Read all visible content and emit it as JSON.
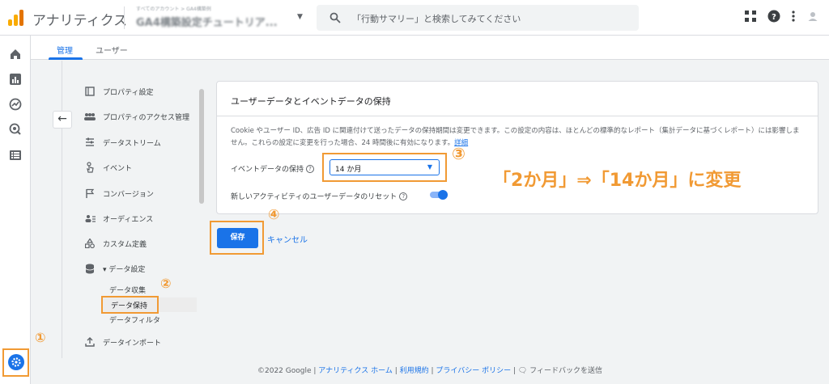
{
  "header": {
    "app_title": "アナリティクス",
    "account_line1": "すべてのアカウント > GA4構築例",
    "account_line2": "GA4構築設定チュートリア...",
    "search_placeholder": "「行動サマリー」と検索してみてください"
  },
  "tabs": [
    {
      "label": "管理"
    },
    {
      "label": "ユーザー"
    }
  ],
  "nav": {
    "items": [
      {
        "label": "プロパティ設定",
        "icon": "property-icon"
      },
      {
        "label": "プロパティのアクセス管理",
        "icon": "people-icon"
      },
      {
        "label": "データストリーム",
        "icon": "stream-icon"
      },
      {
        "label": "イベント",
        "icon": "touch-icon"
      },
      {
        "label": "コンバージョン",
        "icon": "flag-icon"
      },
      {
        "label": "オーディエンス",
        "icon": "audience-icon"
      },
      {
        "label": "カスタム定義",
        "icon": "shapes-icon"
      },
      {
        "label": "▾ データ設定",
        "icon": "database-icon"
      },
      {
        "label": "データインポート",
        "icon": "upload-icon"
      }
    ],
    "sub_items": [
      {
        "label": "データ収集"
      },
      {
        "label": "データ保持"
      },
      {
        "label": "データフィルタ"
      }
    ]
  },
  "card": {
    "title": "ユーザーデータとイベントデータの保持",
    "description": "Cookie やユーザー ID、広告 ID に関連付けて送ったデータの保持期間は変更できます。この設定の内容は、ほとんどの標準的なレポート（集計データに基づくレポート）には影響しません。これらの設定に変更を行った場合、24 時間後に有効になります。",
    "details_link": "詳細",
    "event_retention_label": "イベントデータの保持",
    "event_retention_value": "14 か月",
    "reset_label": "新しいアクティビティのユーザーデータのリセット",
    "reset_enabled": true
  },
  "actions": {
    "save": "保存",
    "cancel": "キャンセル"
  },
  "annotations": {
    "c1": "①",
    "c2": "②",
    "c3": "③",
    "c4": "④",
    "note": "「2か月」⇒「14か月」に変更"
  },
  "footer": {
    "copyright": "©2022 Google | ",
    "home": "アナリティクス ホーム",
    "terms": "利用規約",
    "privacy": "プライバシー ポリシー",
    "feedback": "フィードバックを送信",
    "sep": " | "
  },
  "colors": {
    "accent": "#1a73e8",
    "annotation": "#f19a34"
  }
}
